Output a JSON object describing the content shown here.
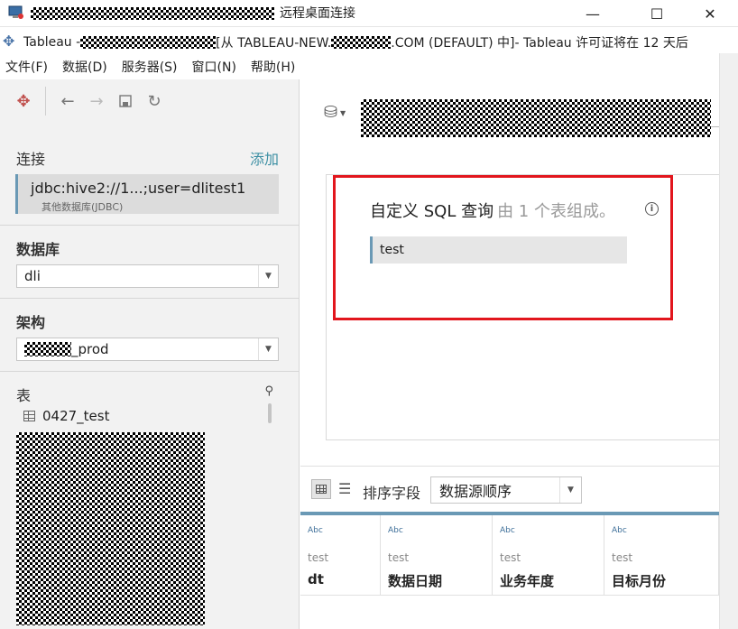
{
  "window": {
    "rdp_title": "远程桌面连接",
    "minimize_label": "—",
    "maximize_label": "☐",
    "close_label": "✕"
  },
  "app": {
    "title_prefix": "Tableau - ",
    "title_mid": "[从 TABLEAU-NEW.",
    "title_suffix": ".COM (DEFAULT) 中]- Tableau 许可证将在 12 天后"
  },
  "menu": [
    "文件(F)",
    "数据(D)",
    "服务器(S)",
    "窗口(N)",
    "帮助(H)"
  ],
  "left": {
    "connections_label": "连接",
    "add_label": "添加",
    "connection": {
      "name": "jdbc:hive2://1...;user=dlitest1",
      "type": "其他数据库(JDBC)"
    },
    "database_label": "数据库",
    "database_value": "dli",
    "schema_label": "架构",
    "schema_suffix": "_prod",
    "table_label": "表",
    "tables": [
      "0427_test"
    ]
  },
  "canvas": {
    "title": "自定义 SQL 查询",
    "subtitle": "由 1 个表组成。",
    "info_glyph": "i",
    "item": "test"
  },
  "grid": {
    "sort_label": "排序字段",
    "sort_value": "数据源顺序",
    "columns": [
      {
        "type": "Abc",
        "sample": "test",
        "name": "dt"
      },
      {
        "type": "Abc",
        "sample": "test",
        "name": "数据日期"
      },
      {
        "type": "Abc",
        "sample": "test",
        "name": "业务年度"
      },
      {
        "type": "Abc",
        "sample": "test",
        "name": "目标月份"
      }
    ]
  },
  "colors": {
    "accent": "#6a99b5",
    "link": "#3e90a4",
    "highlight": "#e2161d"
  }
}
